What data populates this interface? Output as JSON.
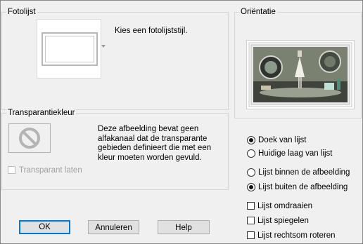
{
  "frame_group": {
    "title": "Fotolijst",
    "prompt": "Kies een fotolijststijl."
  },
  "transparency_group": {
    "title": "Transparantiekleur",
    "message": "Deze afbeelding bevat geen alfakanaal dat de transparante gebieden definieert die met een kleur moeten worden gevuld.",
    "checkbox_label": "Transparant laten",
    "checkbox_checked": false,
    "checkbox_disabled": true
  },
  "orientation_group": {
    "title": "Oriëntatie",
    "canvas_radio": {
      "label": "Doek van lijst",
      "checked": true
    },
    "layer_radio": {
      "label": "Huidige laag van lijst",
      "checked": false
    },
    "inside_radio": {
      "label": "Lijst binnen de afbeelding",
      "checked": false
    },
    "outside_radio": {
      "label": "Lijst buiten de afbeelding",
      "checked": true
    },
    "flip_checkbox": {
      "label": "Lijst omdraaien",
      "checked": false
    },
    "mirror_checkbox": {
      "label": "Lijst spiegelen",
      "checked": false
    },
    "rotate_checkbox": {
      "label": "Lijst rechtsom roteren",
      "checked": false
    }
  },
  "buttons": {
    "ok": "OK",
    "cancel": "Annuleren",
    "help": "Help"
  },
  "colors": {
    "accent": "#0078d7",
    "background": "#f0f0f0"
  }
}
